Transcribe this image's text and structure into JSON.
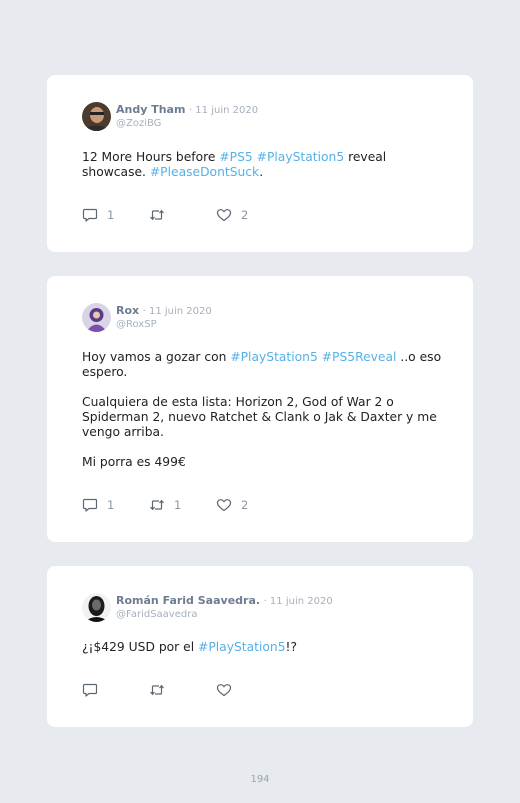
{
  "tweets": [
    {
      "name": "Andy Tham",
      "date": "· 11 juin 2020",
      "handle": "@ZoziBG",
      "paragraphs": [
        [
          {
            "t": "12 More Hours before "
          },
          {
            "t": "#PS5",
            "tag": true
          },
          {
            "t": " "
          },
          {
            "t": "#PlayStation5",
            "tag": true
          },
          {
            "t": " reveal showcase. "
          },
          {
            "t": "#PleaseDontSuck",
            "tag": true
          },
          {
            "t": "."
          }
        ]
      ],
      "replies": "1",
      "retweets": "",
      "likes": "2"
    },
    {
      "name": "Rox",
      "date": "· 11 juin 2020",
      "handle": "@RoxSP",
      "paragraphs": [
        [
          {
            "t": "Hoy vamos a gozar con "
          },
          {
            "t": "#PlayStation5",
            "tag": true
          },
          {
            "t": " "
          },
          {
            "t": "#PS5Reveal",
            "tag": true
          },
          {
            "t": " ..o eso espero."
          }
        ],
        [
          {
            "t": "Cualquiera de esta lista: Horizon 2, God of War 2 o Spiderman 2, nuevo Ratchet & Clank o Jak & Daxter y me vengo arriba."
          }
        ],
        [
          {
            "t": "Mi porra es 499€"
          }
        ]
      ],
      "replies": "1",
      "retweets": "1",
      "likes": "2"
    },
    {
      "name": "Román Farid Saavedra.",
      "date": "· 11 juin 2020",
      "handle": "@FaridSaavedra",
      "paragraphs": [
        [
          {
            "t": "¿¡$429 USD por el "
          },
          {
            "t": "#PlayStation5",
            "tag": true
          },
          {
            "t": "!?"
          }
        ]
      ],
      "replies": "",
      "retweets": "",
      "likes": ""
    }
  ],
  "page_number": "194",
  "icons": {
    "reply": "reply-icon",
    "retweet": "retweet-icon",
    "like": "heart-icon"
  },
  "colors": {
    "background": "#e7eaef",
    "card": "#ffffff",
    "hashtag": "#56b1e6",
    "name": "#6c7d92",
    "muted": "#a5b0bd"
  }
}
